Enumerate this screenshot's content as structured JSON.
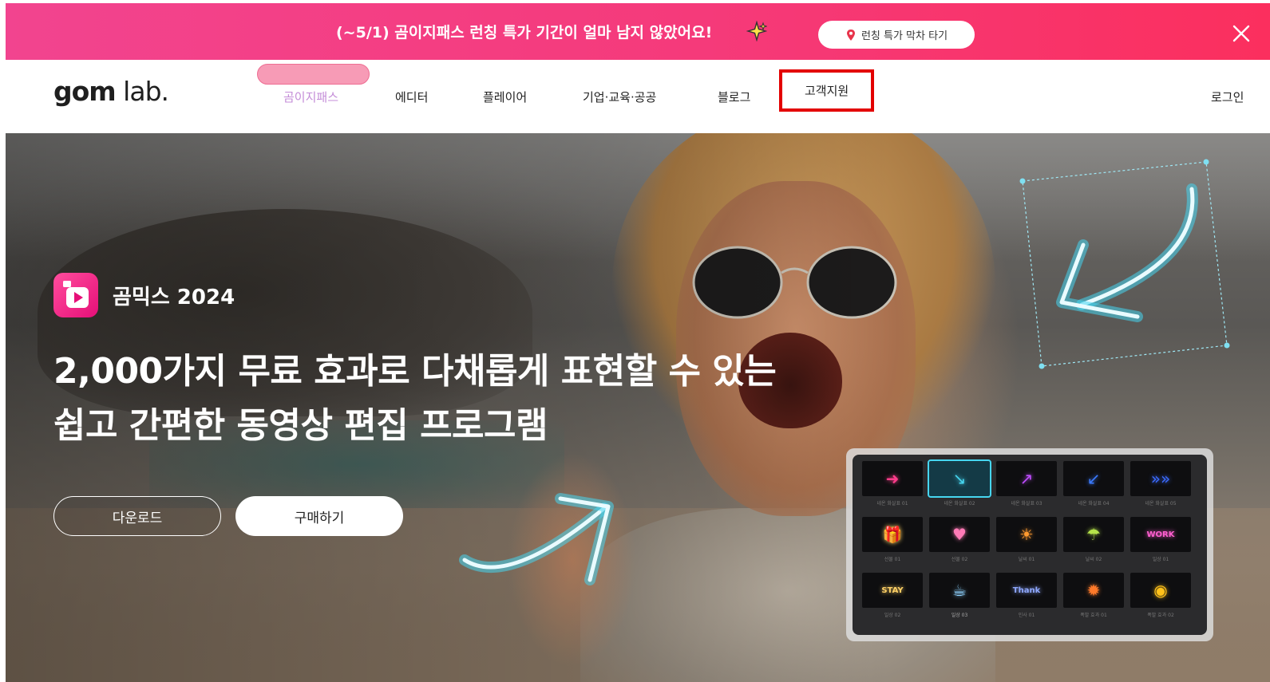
{
  "promo": {
    "text": "(~5/1) 곰이지패스 런칭 특가 기간이 얼마 남지 않았어요!",
    "button_label": "런칭 특가 막차 타기",
    "bg_color": "#f53a7a"
  },
  "nav": {
    "logo_bold": "gom",
    "logo_light": " lab.",
    "items": [
      {
        "label": "곰이지패스",
        "active": true
      },
      {
        "label": "에디터"
      },
      {
        "label": "플레이어"
      },
      {
        "label": "기업·교육·공공"
      },
      {
        "label": "블로그"
      },
      {
        "label": "고객지원",
        "highlighted": true
      }
    ],
    "login_label": "로그인",
    "active_color": "#c48dd8",
    "highlight_color": "#e30000"
  },
  "hero": {
    "app_name": "곰믹스 2024",
    "headline_line1": "2,000가지 무료 효과로 다채롭게 표현할 수 있는",
    "headline_line2": "쉽고 간편한 동영상 편집 프로그램",
    "download_label": "다운로드",
    "buy_label": "구매하기",
    "accent_color": "#e60f78",
    "neon_color": "#46d6f0"
  },
  "effects_panel": {
    "items": [
      {
        "icon": "pink-arrow-right",
        "glyph": "➜",
        "color": "#ff3d8b",
        "label": "네온 화살표 01"
      },
      {
        "icon": "blue-curved-arrow",
        "glyph": "↘",
        "color": "#46d6f0",
        "label": "네온 화살표 02",
        "selected": true
      },
      {
        "icon": "purple-zigzag-arrow",
        "glyph": "↗",
        "color": "#c04dff",
        "label": "네온 화살표 03"
      },
      {
        "icon": "blue-diagonal-arrow",
        "glyph": "↙",
        "color": "#3b7bff",
        "label": "네온 화살표 04"
      },
      {
        "icon": "blue-chevrons",
        "glyph": "»»",
        "color": "#3b6bff",
        "label": "네온 화살표 05"
      },
      {
        "icon": "gift-box",
        "glyph": "🎁",
        "color": "#ffd166",
        "label": "선물 01"
      },
      {
        "icon": "heart-gift",
        "glyph": "♥",
        "color": "#ff7ab6",
        "label": "선물 02"
      },
      {
        "icon": "sunshine",
        "glyph": "☀",
        "color": "#ff9a2f",
        "label": "날씨 01"
      },
      {
        "icon": "rainy-day",
        "glyph": "☂",
        "color": "#b6e34a",
        "label": "날씨 02"
      },
      {
        "icon": "work-work-work",
        "glyph": "WORK",
        "color": "#ff5fd0",
        "label": "일상 01"
      },
      {
        "icon": "stay-at-home",
        "glyph": "STAY",
        "color": "#ffd166",
        "label": "일상 02"
      },
      {
        "icon": "coffee",
        "glyph": "☕",
        "color": "#8fd3ff",
        "label": "일상 03",
        "selected_label": true
      },
      {
        "icon": "thank-you",
        "glyph": "Thank",
        "color": "#8fa8ff",
        "label": "인사 01"
      },
      {
        "icon": "fire-sparks",
        "glyph": "✹",
        "color": "#ff7a2a",
        "label": "폭발 효과 01"
      },
      {
        "icon": "gold-ring",
        "glyph": "◉",
        "color": "#ffc21a",
        "label": "폭발 효과 02"
      }
    ]
  }
}
